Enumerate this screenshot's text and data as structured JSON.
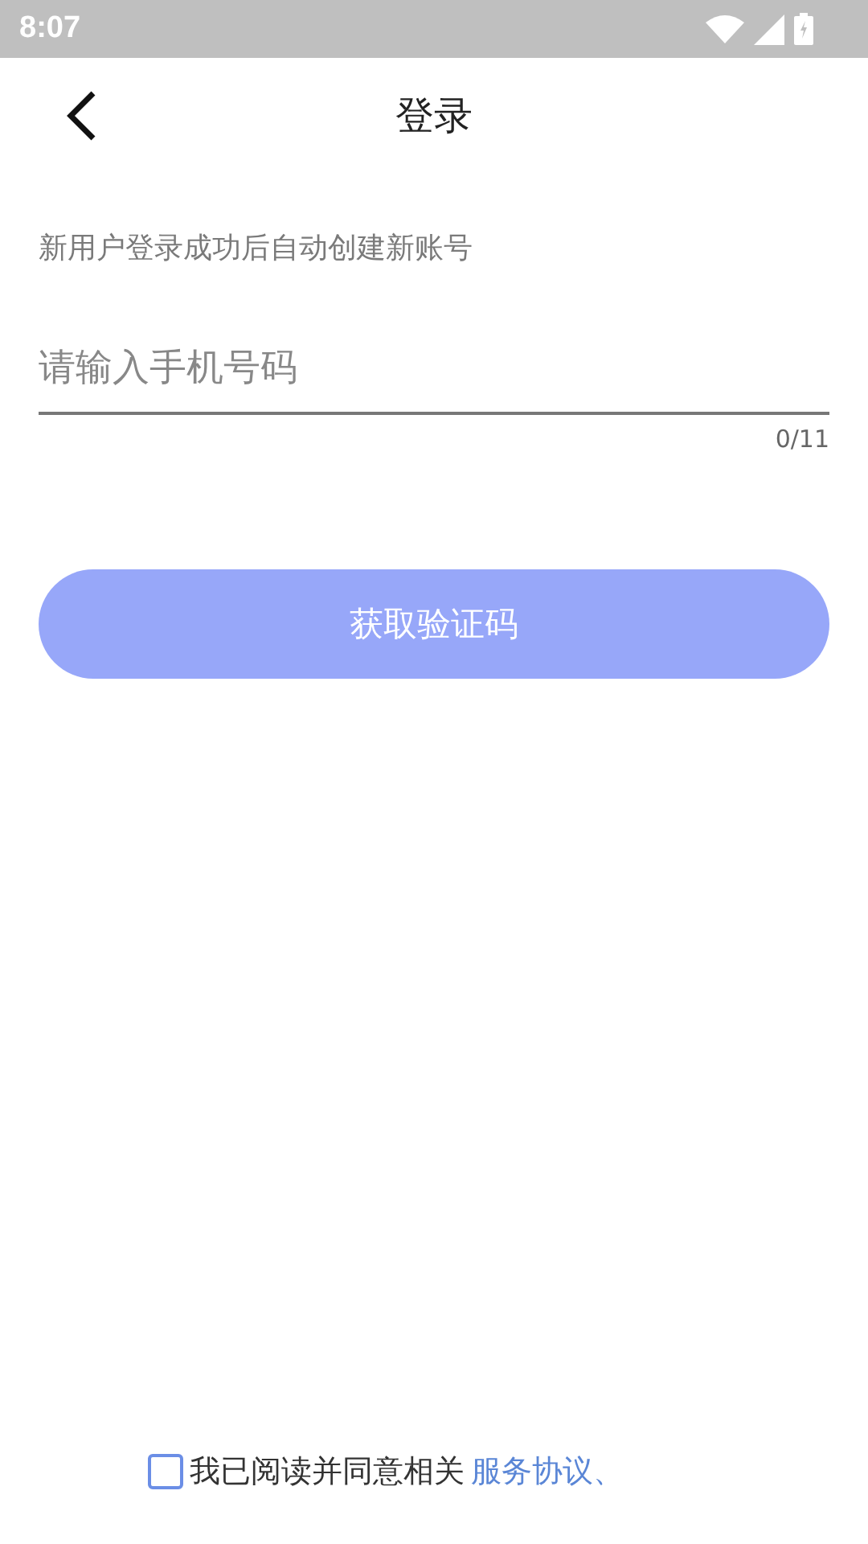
{
  "status_bar": {
    "time": "8:07"
  },
  "header": {
    "title": "登录"
  },
  "hint": "新用户登录成功后自动创建新账号",
  "phone_field": {
    "placeholder": "请输入手机号码",
    "counter": "0/11"
  },
  "code_button": {
    "label": "获取验证码",
    "disabled": true
  },
  "agreement": {
    "checked": false,
    "text": "我已阅读并同意相关",
    "link": "服务协议、"
  }
}
